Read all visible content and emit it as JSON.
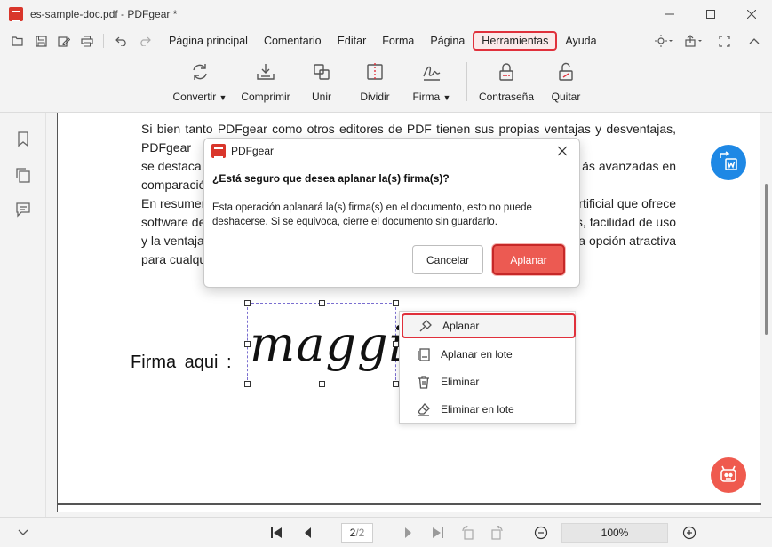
{
  "window": {
    "title": "es-sample-doc.pdf - PDFgear *",
    "controls": [
      "minimize-icon",
      "maximize-icon",
      "close-icon"
    ]
  },
  "quick_access": [
    "open-folder-icon",
    "save-icon",
    "edit-icon",
    "print-icon",
    "undo-icon",
    "redo-icon"
  ],
  "menu": {
    "items": [
      {
        "label": "Página principal"
      },
      {
        "label": "Comentario"
      },
      {
        "label": "Editar"
      },
      {
        "label": "Forma"
      },
      {
        "label": "Página"
      },
      {
        "label": "Herramientas",
        "active": true
      },
      {
        "label": "Ayuda"
      }
    ],
    "right_icons": [
      "theme-icon",
      "share-icon",
      "fullscreen-icon",
      "collapse-icon"
    ]
  },
  "ribbon": {
    "buttons": [
      {
        "label": "Convertir",
        "icon": "convert-icon",
        "dropdown": true
      },
      {
        "label": "Comprimir",
        "icon": "compress-icon",
        "dropdown": false
      },
      {
        "label": "Unir",
        "icon": "merge-icon",
        "dropdown": false
      },
      {
        "label": "Dividir",
        "icon": "split-icon",
        "dropdown": false
      },
      {
        "label": "Firma",
        "icon": "signature-icon",
        "dropdown": true
      },
      {
        "label": "Contraseña",
        "icon": "lock-icon",
        "dropdown": false
      },
      {
        "label": "Quitar",
        "icon": "unlock-icon",
        "dropdown": false
      }
    ]
  },
  "sidebar": {
    "icons": [
      "bookmark-icon",
      "pages-icon",
      "comment-icon"
    ],
    "bottom_icon": "chevron-down-icon"
  },
  "document": {
    "para1_l1": "Si bien tanto PDFgear como otros editores de PDF tienen sus propias ventajas y desventajas, PDFgear",
    "para1_l2": "se destaca",
    "para1_l2_end": "ás avanzadas en",
    "para1_l3": "comparació",
    "para2_l1": "En resumen",
    "para2_l1_end": "rtificial que ofrece",
    "para2_l2": "software de",
    "para2_l2_end": "s, facilidad de uso",
    "para2_l3": "y la ventaja",
    "para2_l3_end": "a opción atractiva",
    "para2_l4": "para cualqu",
    "signature_label": "Firma aqui :",
    "signature_text": "maggie"
  },
  "dialog": {
    "title": "PDFgear",
    "question": "¿Está seguro que desea aplanar la(s) firma(s)?",
    "body": "Esta operación aplanará la(s) firma(s) en el documento, esto no puede deshacerse. Si se equivoca, cierre el documento sin guardarlo.",
    "cancel_label": "Cancelar",
    "confirm_label": "Aplanar"
  },
  "context_menu": {
    "items": [
      {
        "label": "Aplanar",
        "icon": "flatten-icon",
        "highlighted": true
      },
      {
        "label": "Aplanar en lote",
        "icon": "batch-flatten-icon"
      },
      {
        "label": "Eliminar",
        "icon": "trash-icon"
      },
      {
        "label": "Eliminar en lote",
        "icon": "batch-erase-icon"
      }
    ]
  },
  "floating": {
    "top_button_icon": "convert-word-icon",
    "bottom_button_icon": "ai-robot-icon"
  },
  "statusbar": {
    "current_page": "2",
    "total_pages": "/2",
    "zoom": "100%"
  },
  "colors": {
    "accent_red": "#e0303b",
    "blue_fab": "#1e88e5",
    "red_fab": "#ef5a4e",
    "confirm_button": "#ec5a52"
  }
}
